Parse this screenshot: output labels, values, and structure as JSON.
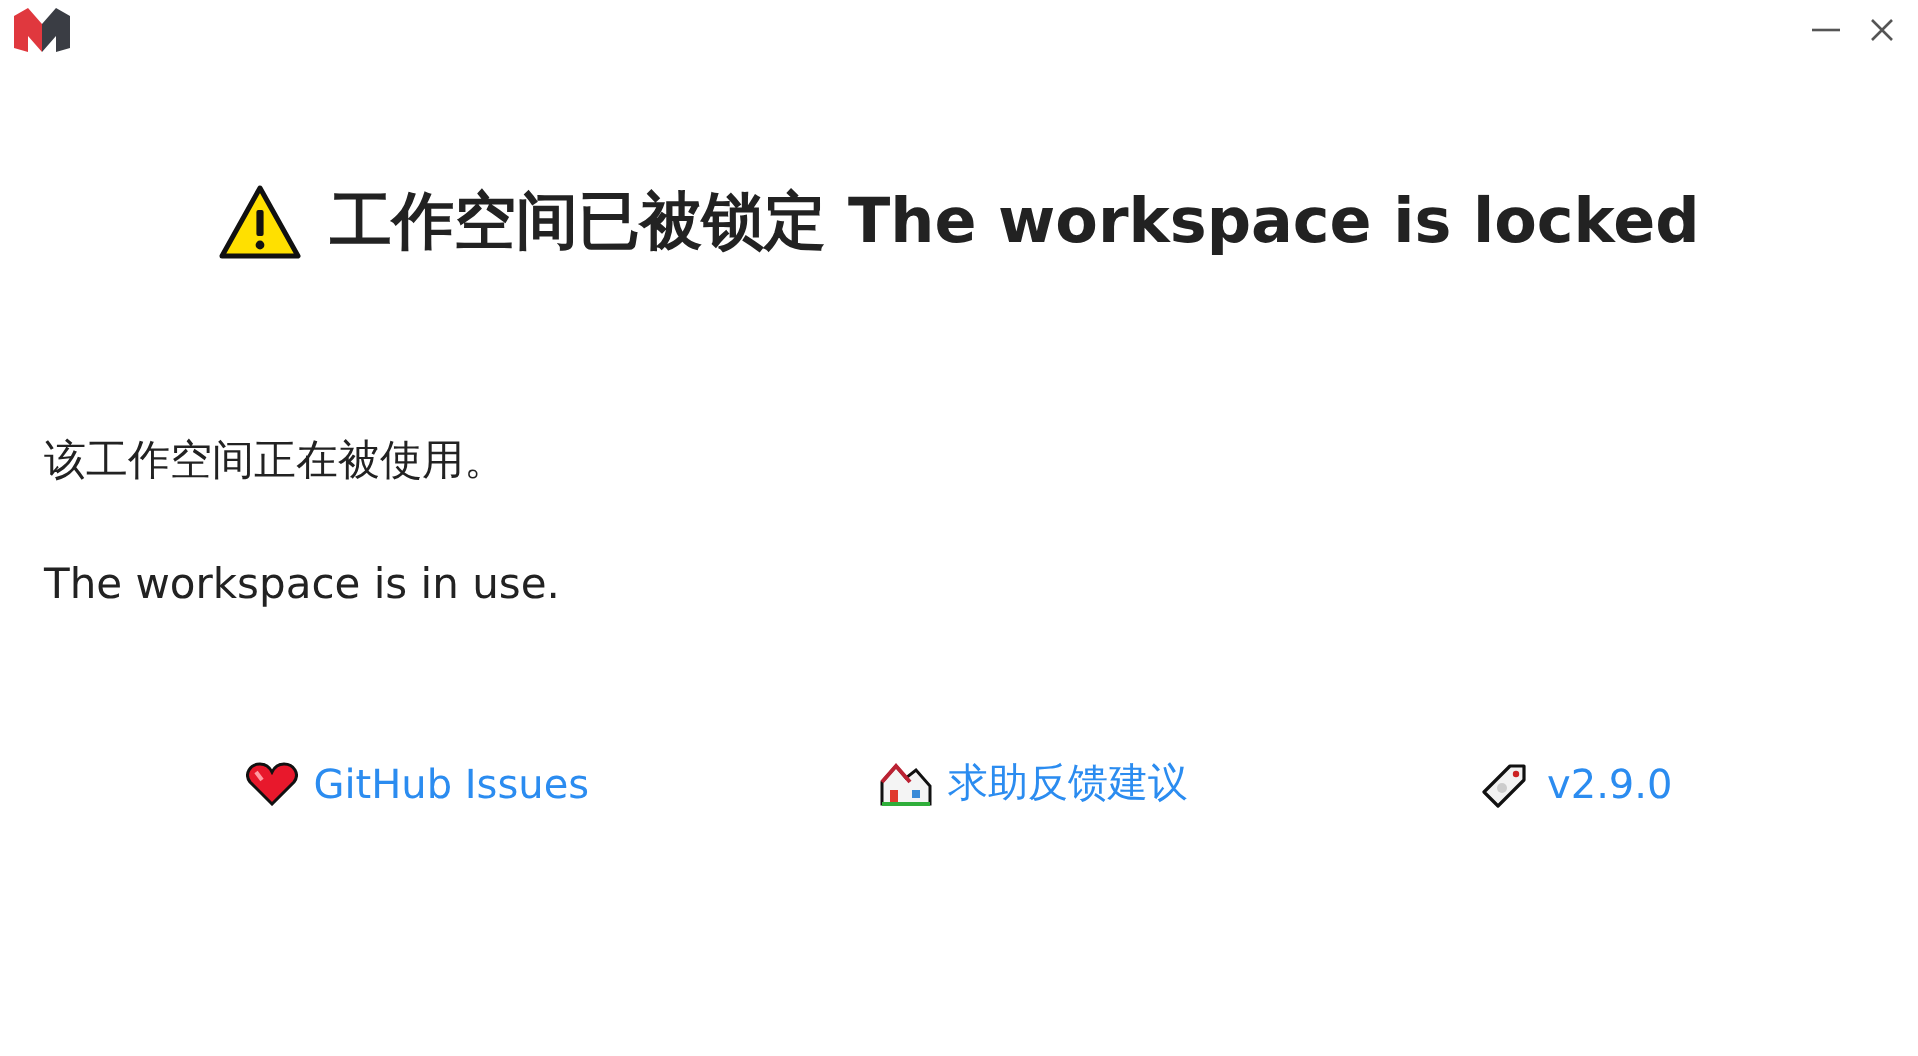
{
  "heading": "工作空间已被锁定 The workspace is locked",
  "messages": [
    "该工作空间正在被使用。",
    "The workspace is in use."
  ],
  "links": [
    {
      "kind": "heart",
      "label": "GitHub Issues"
    },
    {
      "kind": "house",
      "label": "求助反馈建议"
    },
    {
      "kind": "tag",
      "label": "v2.9.0"
    }
  ]
}
